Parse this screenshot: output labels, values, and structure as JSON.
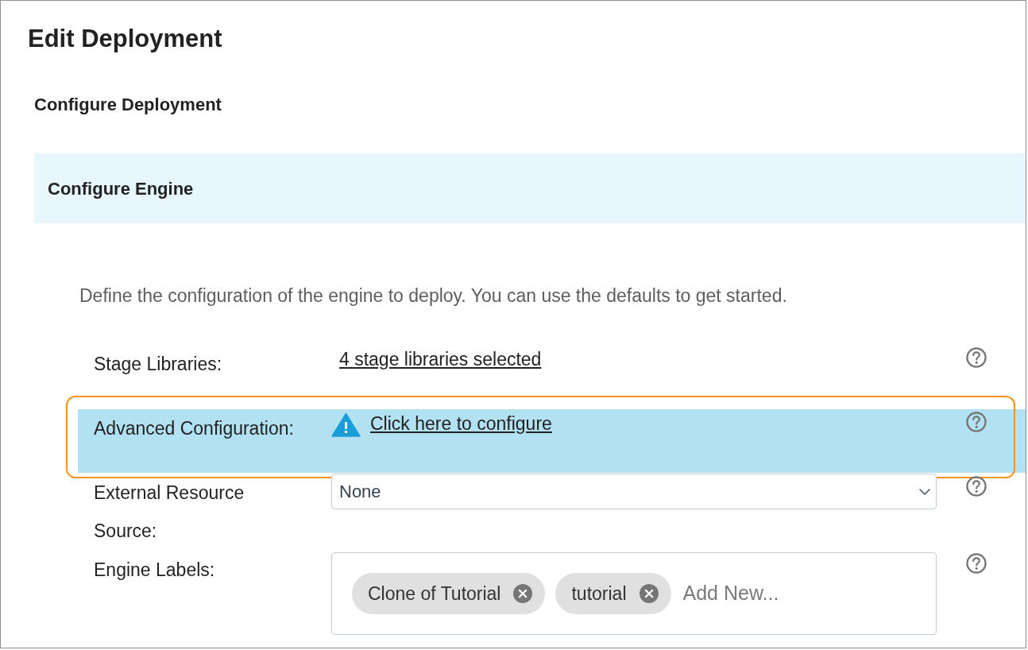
{
  "page": {
    "title": "Edit Deployment"
  },
  "section": {
    "title": "Configure Deployment"
  },
  "panel": {
    "title": "Configure Engine",
    "description": "Define the configuration of the engine to deploy. You can use the defaults to get started."
  },
  "fields": [
    {
      "kind": "link",
      "label": "Stage Libraries:",
      "value": "4 stage libraries selected",
      "warning": false,
      "highlighted": false
    },
    {
      "kind": "link",
      "label": "Advanced Configuration:",
      "value": "Click here to configure",
      "warning": true,
      "highlighted": true
    },
    {
      "kind": "select",
      "label": "External Resource Source:",
      "value": "None",
      "highlighted": false
    },
    {
      "kind": "tags",
      "label": "Engine Labels:",
      "tags": [
        "Clone of Tutorial",
        "tutorial"
      ],
      "placeholder": "Add New...",
      "highlighted": false
    }
  ]
}
